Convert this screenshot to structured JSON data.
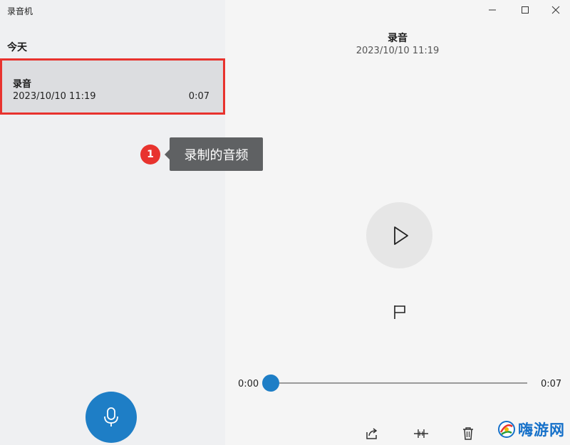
{
  "window": {
    "title": "录音机"
  },
  "sidebar": {
    "section_header": "今天",
    "recordings": [
      {
        "name": "录音",
        "date": "2023/10/10 11:19",
        "duration": "0:07"
      }
    ]
  },
  "annotation": {
    "badge": "1",
    "tooltip": "录制的音频"
  },
  "player": {
    "title": "录音",
    "date": "2023/10/10 11:19",
    "current_time": "0:00",
    "total_time": "0:07",
    "progress": 0
  },
  "icons": {
    "minimize": "minimize-icon",
    "maximize": "maximize-icon",
    "close": "close-icon",
    "play": "play-icon",
    "flag": "flag-icon",
    "microphone": "microphone-icon",
    "share": "share-icon",
    "trim": "trim-icon",
    "delete": "delete-icon",
    "more": "more-icon"
  },
  "colors": {
    "accent": "#1e7ec6",
    "highlight_border": "#e8332e",
    "tooltip_bg": "#5f6163"
  },
  "watermark": {
    "text": "嗨游网"
  }
}
